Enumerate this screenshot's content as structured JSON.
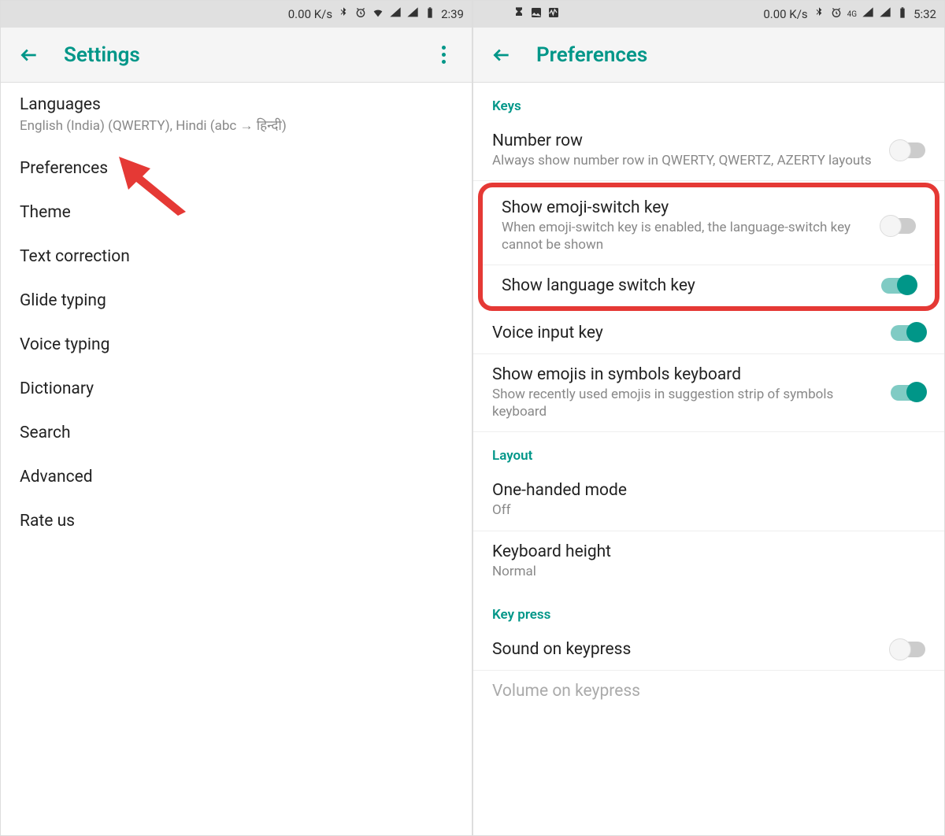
{
  "left": {
    "statusbar": {
      "speed": "0.00 K/s",
      "time": "2:39"
    },
    "appbar": {
      "title": "Settings"
    },
    "items": [
      {
        "title": "Languages",
        "subtitle": "English (India) (QWERTY), Hindi (abc → हिन्दी)"
      },
      {
        "title": "Preferences"
      },
      {
        "title": "Theme"
      },
      {
        "title": "Text correction"
      },
      {
        "title": "Glide typing"
      },
      {
        "title": "Voice typing"
      },
      {
        "title": "Dictionary"
      },
      {
        "title": "Search"
      },
      {
        "title": "Advanced"
      },
      {
        "title": "Rate us"
      }
    ]
  },
  "right": {
    "statusbar": {
      "speed": "0.00 K/s",
      "time": "5:32",
      "net_badge": "4G"
    },
    "appbar": {
      "title": "Preferences"
    },
    "sections": {
      "keys_header": "Keys",
      "number_row": {
        "title": "Number row",
        "subtitle": "Always show number row in QWERTY, QWERTZ, AZERTY layouts",
        "on": false
      },
      "emoji_switch": {
        "title": "Show emoji-switch key",
        "subtitle": "When emoji-switch key is enabled, the language-switch key cannot be shown",
        "on": false
      },
      "lang_switch": {
        "title": "Show language switch key",
        "on": true
      },
      "voice_input": {
        "title": "Voice input key",
        "on": true
      },
      "emoji_symbols": {
        "title": "Show emojis in symbols keyboard",
        "subtitle": "Show recently used emojis in suggestion strip of symbols keyboard",
        "on": true
      },
      "layout_header": "Layout",
      "one_handed": {
        "title": "One-handed mode",
        "subtitle": "Off"
      },
      "kb_height": {
        "title": "Keyboard height",
        "subtitle": "Normal"
      },
      "keypress_header": "Key press",
      "sound": {
        "title": "Sound on keypress",
        "on": false
      },
      "volume": {
        "title": "Volume on keypress"
      }
    }
  }
}
